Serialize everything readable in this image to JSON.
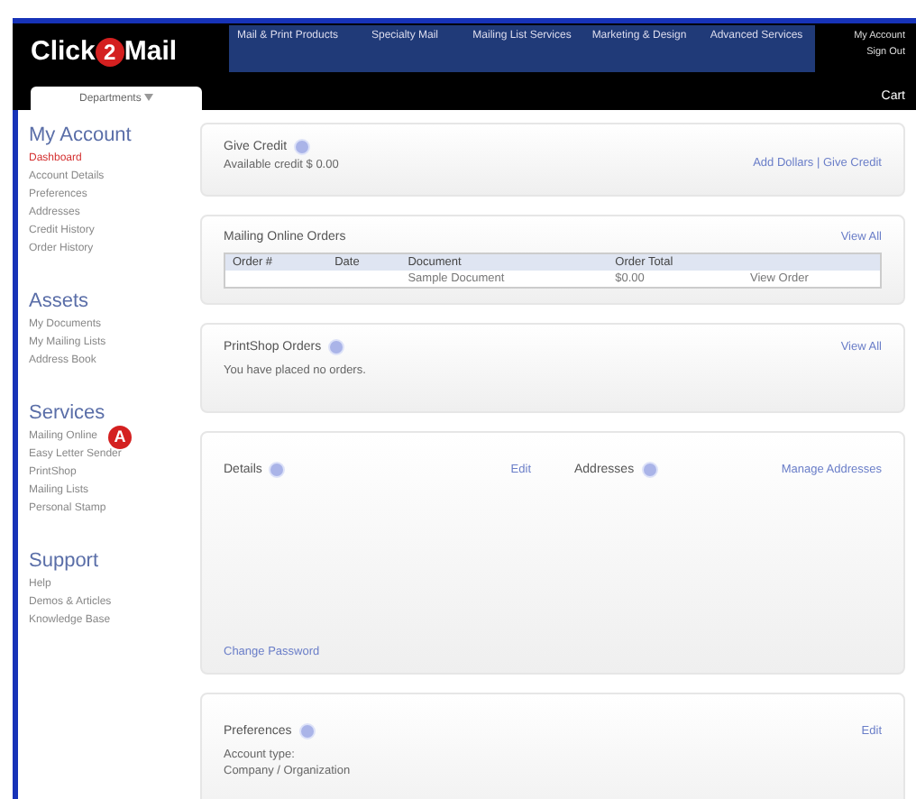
{
  "header": {
    "logo": {
      "left": "Click",
      "badge": "2",
      "right": "Mail"
    },
    "nav": [
      "Mail & Print Products",
      "Specialty Mail",
      "Mailing List Services",
      "Marketing & Design",
      "Advanced Services"
    ],
    "account_links": [
      "My Account",
      "Sign Out"
    ],
    "departments": "Departments",
    "cart": "Cart"
  },
  "sidebar": [
    {
      "title": "My Account",
      "items": [
        {
          "label": "Dashboard",
          "selected": true
        },
        {
          "label": "Account Details",
          "selected": false
        },
        {
          "label": "Preferences",
          "selected": false
        },
        {
          "label": "Addresses",
          "selected": false
        },
        {
          "label": "Credit History",
          "selected": false
        },
        {
          "label": "Order History",
          "selected": false
        }
      ]
    },
    {
      "title": "Assets",
      "items": [
        {
          "label": "My Documents",
          "selected": false
        },
        {
          "label": "My Mailing Lists",
          "selected": false
        },
        {
          "label": "Address Book",
          "selected": false
        }
      ]
    },
    {
      "title": "Services",
      "items": [
        {
          "label": "Mailing Online",
          "selected": false,
          "callout": "A"
        },
        {
          "label": "Easy Letter Sender",
          "selected": false
        },
        {
          "label": "PrintShop",
          "selected": false
        },
        {
          "label": "Mailing Lists",
          "selected": false
        },
        {
          "label": "Personal Stamp",
          "selected": false
        }
      ]
    },
    {
      "title": "Support",
      "items": [
        {
          "label": "Help",
          "selected": false
        },
        {
          "label": "Demos & Articles",
          "selected": false
        },
        {
          "label": "Knowledge Base",
          "selected": false
        }
      ]
    }
  ],
  "credit": {
    "title": "Give Credit",
    "text": "Available credit $ 0.00",
    "links": "Add Dollars | Give Credit"
  },
  "orders": {
    "title": "Mailing Online Orders",
    "link": "View All",
    "columns": [
      "Order #",
      "Date",
      "Document",
      "Order Total",
      ""
    ],
    "rows": [
      [
        "",
        "",
        "Sample Document",
        "$0.00",
        "View Order"
      ]
    ]
  },
  "printshop": {
    "title": "PrintShop Orders",
    "text": "You have placed no orders.",
    "link": "View All"
  },
  "details": {
    "title": "Details",
    "edit": "Edit",
    "addresses_title": "Addresses",
    "addresses_link": "Manage Addresses",
    "password_link": "Change Password"
  },
  "preferences": {
    "title": "Preferences",
    "edit": "Edit",
    "label": "Account type:",
    "value": "Company / Organization"
  }
}
